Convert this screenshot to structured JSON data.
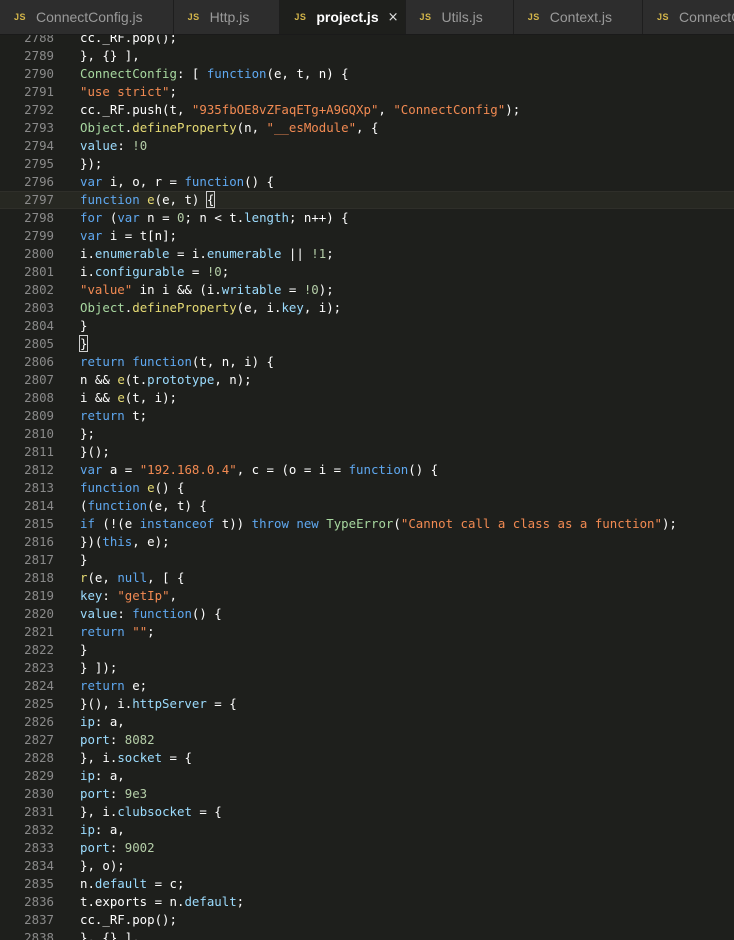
{
  "tabs": [
    {
      "icon": "JS",
      "label": "ConnectConfig.js",
      "active": false
    },
    {
      "icon": "JS",
      "label": "Http.js",
      "active": false
    },
    {
      "icon": "JS",
      "label": "project.js",
      "active": true,
      "close": "×"
    },
    {
      "icon": "JS",
      "label": "Utils.js",
      "active": false
    },
    {
      "icon": "JS",
      "label": "Context.js",
      "active": false
    },
    {
      "icon": "JS",
      "label": "ConnectConfi",
      "active": false
    }
  ],
  "editor": {
    "current_line": 2796,
    "lines": [
      {
        "n": "2788",
        "tokens": [
          [
            "punc",
            "cc._RF.pop();"
          ]
        ]
      },
      {
        "n": "2789",
        "tokens": [
          [
            "punc",
            "}, {} ],"
          ]
        ]
      },
      {
        "n": "2790",
        "tokens": [
          [
            "obj",
            "ConnectConfig"
          ],
          [
            "punc",
            ": [ "
          ],
          [
            "kw",
            "function"
          ],
          [
            "punc",
            "(e, t, n) {"
          ]
        ]
      },
      {
        "n": "2791",
        "tokens": [
          [
            "str",
            "\"use strict\""
          ],
          [
            "punc",
            ";"
          ]
        ]
      },
      {
        "n": "2792",
        "tokens": [
          [
            "punc",
            "cc._RF.push(t, "
          ],
          [
            "str",
            "\"935fbOE8vZFaqETg+A9GQXp\""
          ],
          [
            "punc",
            ", "
          ],
          [
            "str",
            "\"ConnectConfig\""
          ],
          [
            "punc",
            ");"
          ]
        ]
      },
      {
        "n": "2793",
        "tokens": [
          [
            "obj",
            "Object"
          ],
          [
            "punc",
            "."
          ],
          [
            "fn",
            "defineProperty"
          ],
          [
            "punc",
            "(n, "
          ],
          [
            "str",
            "\"__esModule\""
          ],
          [
            "punc",
            ", {"
          ]
        ]
      },
      {
        "n": "2794",
        "tokens": [
          [
            "prop",
            "value"
          ],
          [
            "punc",
            ": "
          ],
          [
            "num",
            "!0"
          ]
        ]
      },
      {
        "n": "2795",
        "tokens": [
          [
            "punc",
            "});"
          ]
        ]
      },
      {
        "n": "2796",
        "tokens": [
          [
            "kw",
            "var"
          ],
          [
            "punc",
            " i, o, r = "
          ],
          [
            "kw",
            "function"
          ],
          [
            "punc",
            "() {"
          ]
        ]
      },
      {
        "n": "2797",
        "tokens": [
          [
            "kw",
            "function"
          ],
          [
            "punc",
            " "
          ],
          [
            "fn",
            "e"
          ],
          [
            "punc",
            "(e, t) "
          ],
          [
            "cursor",
            "{"
          ]
        ]
      },
      {
        "n": "2798",
        "tokens": [
          [
            "kw",
            "for"
          ],
          [
            "punc",
            " ("
          ],
          [
            "kw",
            "var"
          ],
          [
            "punc",
            " n = "
          ],
          [
            "num",
            "0"
          ],
          [
            "punc",
            "; n < t."
          ],
          [
            "prop",
            "length"
          ],
          [
            "punc",
            "; n++) {"
          ]
        ]
      },
      {
        "n": "2799",
        "tokens": [
          [
            "kw",
            "var"
          ],
          [
            "punc",
            " i = t[n];"
          ]
        ]
      },
      {
        "n": "2800",
        "tokens": [
          [
            "punc",
            "i."
          ],
          [
            "prop",
            "enumerable"
          ],
          [
            "punc",
            " = i."
          ],
          [
            "prop",
            "enumerable"
          ],
          [
            "punc",
            " || "
          ],
          [
            "num",
            "!1"
          ],
          [
            "punc",
            ";"
          ]
        ]
      },
      {
        "n": "2801",
        "tokens": [
          [
            "punc",
            "i."
          ],
          [
            "prop",
            "configurable"
          ],
          [
            "punc",
            " = "
          ],
          [
            "num",
            "!0"
          ],
          [
            "punc",
            ";"
          ]
        ]
      },
      {
        "n": "2802",
        "tokens": [
          [
            "str",
            "\"value\""
          ],
          [
            "punc",
            " in i && (i."
          ],
          [
            "prop",
            "writable"
          ],
          [
            "punc",
            " = "
          ],
          [
            "num",
            "!0"
          ],
          [
            "punc",
            ");"
          ]
        ]
      },
      {
        "n": "2803",
        "tokens": [
          [
            "obj",
            "Object"
          ],
          [
            "punc",
            "."
          ],
          [
            "fn",
            "defineProperty"
          ],
          [
            "punc",
            "(e, i."
          ],
          [
            "prop",
            "key"
          ],
          [
            "punc",
            ", i);"
          ]
        ]
      },
      {
        "n": "2804",
        "tokens": [
          [
            "punc",
            "}"
          ]
        ]
      },
      {
        "n": "2805",
        "tokens": [
          [
            "cursor",
            "}"
          ]
        ]
      },
      {
        "n": "2806",
        "tokens": [
          [
            "kw",
            "return"
          ],
          [
            "punc",
            " "
          ],
          [
            "kw",
            "function"
          ],
          [
            "punc",
            "(t, n, i) {"
          ]
        ]
      },
      {
        "n": "2807",
        "tokens": [
          [
            "punc",
            "n && "
          ],
          [
            "fn",
            "e"
          ],
          [
            "punc",
            "(t."
          ],
          [
            "prop",
            "prototype"
          ],
          [
            "punc",
            ", n);"
          ]
        ]
      },
      {
        "n": "2808",
        "tokens": [
          [
            "punc",
            "i && "
          ],
          [
            "fn",
            "e"
          ],
          [
            "punc",
            "(t, i);"
          ]
        ]
      },
      {
        "n": "2809",
        "tokens": [
          [
            "kw",
            "return"
          ],
          [
            "punc",
            " t;"
          ]
        ]
      },
      {
        "n": "2810",
        "tokens": [
          [
            "punc",
            "};"
          ]
        ]
      },
      {
        "n": "2811",
        "tokens": [
          [
            "punc",
            "}();"
          ]
        ]
      },
      {
        "n": "2812",
        "tokens": [
          [
            "kw",
            "var"
          ],
          [
            "punc",
            " a = "
          ],
          [
            "str",
            "\"192.168.0.4\""
          ],
          [
            "punc",
            ", c = (o = i = "
          ],
          [
            "kw",
            "function"
          ],
          [
            "punc",
            "() {"
          ]
        ]
      },
      {
        "n": "2813",
        "tokens": [
          [
            "kw",
            "function"
          ],
          [
            "punc",
            " "
          ],
          [
            "fn",
            "e"
          ],
          [
            "punc",
            "() {"
          ]
        ]
      },
      {
        "n": "2814",
        "tokens": [
          [
            "punc",
            "("
          ],
          [
            "kw",
            "function"
          ],
          [
            "punc",
            "(e, t) {"
          ]
        ]
      },
      {
        "n": "2815",
        "tokens": [
          [
            "kw",
            "if"
          ],
          [
            "punc",
            " (!(e "
          ],
          [
            "kw",
            "instanceof"
          ],
          [
            "punc",
            " t)) "
          ],
          [
            "kw",
            "throw"
          ],
          [
            "punc",
            " "
          ],
          [
            "kw",
            "new"
          ],
          [
            "punc",
            " "
          ],
          [
            "obj",
            "TypeError"
          ],
          [
            "punc",
            "("
          ],
          [
            "str",
            "\"Cannot call a class as a function\""
          ],
          [
            "punc",
            ");"
          ]
        ]
      },
      {
        "n": "2816",
        "tokens": [
          [
            "punc",
            "})("
          ],
          [
            "kw",
            "this"
          ],
          [
            "punc",
            ", e);"
          ]
        ]
      },
      {
        "n": "2817",
        "tokens": [
          [
            "punc",
            "}"
          ]
        ]
      },
      {
        "n": "2818",
        "tokens": [
          [
            "fn",
            "r"
          ],
          [
            "punc",
            "(e, "
          ],
          [
            "kw",
            "null"
          ],
          [
            "punc",
            ", [ {"
          ]
        ]
      },
      {
        "n": "2819",
        "tokens": [
          [
            "prop",
            "key"
          ],
          [
            "punc",
            ": "
          ],
          [
            "str",
            "\"getIp\""
          ],
          [
            "punc",
            ","
          ]
        ]
      },
      {
        "n": "2820",
        "tokens": [
          [
            "prop",
            "value"
          ],
          [
            "punc",
            ": "
          ],
          [
            "kw",
            "function"
          ],
          [
            "punc",
            "() {"
          ]
        ]
      },
      {
        "n": "2821",
        "tokens": [
          [
            "kw",
            "return"
          ],
          [
            "punc",
            " "
          ],
          [
            "str",
            "\"\""
          ],
          [
            "punc",
            ";"
          ]
        ]
      },
      {
        "n": "2822",
        "tokens": [
          [
            "punc",
            "}"
          ]
        ]
      },
      {
        "n": "2823",
        "tokens": [
          [
            "punc",
            "} ]);"
          ]
        ]
      },
      {
        "n": "2824",
        "tokens": [
          [
            "kw",
            "return"
          ],
          [
            "punc",
            " e;"
          ]
        ]
      },
      {
        "n": "2825",
        "tokens": [
          [
            "punc",
            "}(), i."
          ],
          [
            "prop",
            "httpServer"
          ],
          [
            "punc",
            " = {"
          ]
        ]
      },
      {
        "n": "2826",
        "tokens": [
          [
            "prop",
            "ip"
          ],
          [
            "punc",
            ": a,"
          ]
        ]
      },
      {
        "n": "2827",
        "tokens": [
          [
            "prop",
            "port"
          ],
          [
            "punc",
            ": "
          ],
          [
            "num",
            "8082"
          ]
        ]
      },
      {
        "n": "2828",
        "tokens": [
          [
            "punc",
            "}, i."
          ],
          [
            "prop",
            "socket"
          ],
          [
            "punc",
            " = {"
          ]
        ]
      },
      {
        "n": "2829",
        "tokens": [
          [
            "prop",
            "ip"
          ],
          [
            "punc",
            ": a,"
          ]
        ]
      },
      {
        "n": "2830",
        "tokens": [
          [
            "prop",
            "port"
          ],
          [
            "punc",
            ": "
          ],
          [
            "num",
            "9e3"
          ]
        ]
      },
      {
        "n": "2831",
        "tokens": [
          [
            "punc",
            "}, i."
          ],
          [
            "prop",
            "clubsocket"
          ],
          [
            "punc",
            " = {"
          ]
        ]
      },
      {
        "n": "2832",
        "tokens": [
          [
            "prop",
            "ip"
          ],
          [
            "punc",
            ": a,"
          ]
        ]
      },
      {
        "n": "2833",
        "tokens": [
          [
            "prop",
            "port"
          ],
          [
            "punc",
            ": "
          ],
          [
            "num",
            "9002"
          ]
        ]
      },
      {
        "n": "2834",
        "tokens": [
          [
            "punc",
            "}, o);"
          ]
        ]
      },
      {
        "n": "2835",
        "tokens": [
          [
            "punc",
            "n."
          ],
          [
            "prop",
            "default"
          ],
          [
            "punc",
            " = c;"
          ]
        ]
      },
      {
        "n": "2836",
        "tokens": [
          [
            "punc",
            "t.exports = n."
          ],
          [
            "prop",
            "default"
          ],
          [
            "punc",
            ";"
          ]
        ]
      },
      {
        "n": "2837",
        "tokens": [
          [
            "punc",
            "cc._RF.pop();"
          ]
        ]
      },
      {
        "n": "2838",
        "tokens": [
          [
            "punc",
            "}, {} ],"
          ]
        ]
      }
    ]
  }
}
